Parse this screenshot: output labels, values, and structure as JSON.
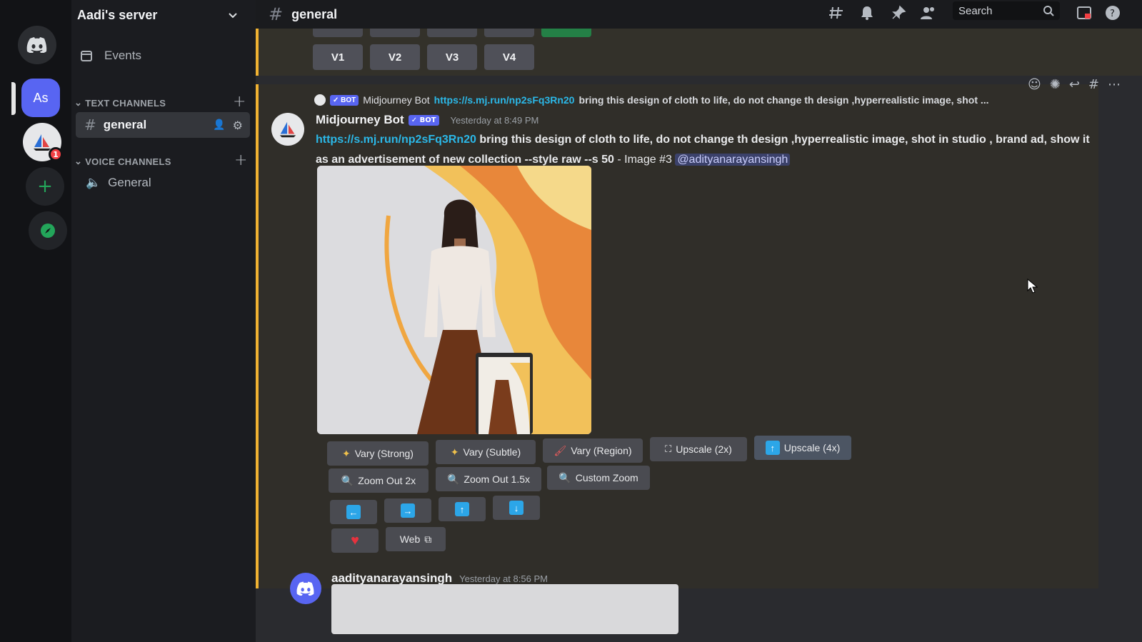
{
  "server": {
    "name": "Aadi's server",
    "rail_initials": "As",
    "notification_count": "1"
  },
  "sidebar": {
    "events_label": "Events",
    "text_channels_label": "TEXT CHANNELS",
    "active_channel": "general",
    "voice_channels_label": "VOICE CHANNELS",
    "voice_channel": "General"
  },
  "topbar": {
    "channel": "general",
    "search_placeholder": "Search"
  },
  "top_message": {
    "buttons": [
      "V1",
      "V2",
      "V3",
      "V4"
    ]
  },
  "bot_message": {
    "reply_author": "Midjourney Bot",
    "reply_link": "https://s.mj.run/np2sFq3Rn20",
    "reply_text": "bring this design of cloth to life, do not change th design ,hyperrealistic image, shot ...",
    "bot_tag": "BOT",
    "author": "Midjourney Bot",
    "timestamp": "Yesterday at 8:49 PM",
    "link": "https://s.mj.run/np2sFq3Rn20",
    "text_bold": "bring this design of cloth to life, do not change th design ,hyperrealistic image, shot in studio , brand ad, show it as an advertisement of new collection --style raw --s 50",
    "text_normal": "- Image #3",
    "mention": "@adityanarayansingh",
    "buttons": {
      "vary_strong": "Vary (Strong)",
      "vary_subtle": "Vary (Subtle)",
      "vary_region": "Vary (Region)",
      "upscale_2x": "Upscale (2x)",
      "upscale_4x": "Upscale (4x)",
      "zoom_out_2x": "Zoom Out 2x",
      "zoom_out_15x": "Zoom Out 1.5x",
      "custom_zoom": "Custom Zoom",
      "web": "Web"
    }
  },
  "next_message": {
    "author": "aadityanarayansingh",
    "timestamp": "Yesterday at 8:56 PM"
  },
  "colors": {
    "accent": "#5865f2",
    "link": "#2bb8e8",
    "highlight_border": "#f0b232"
  }
}
